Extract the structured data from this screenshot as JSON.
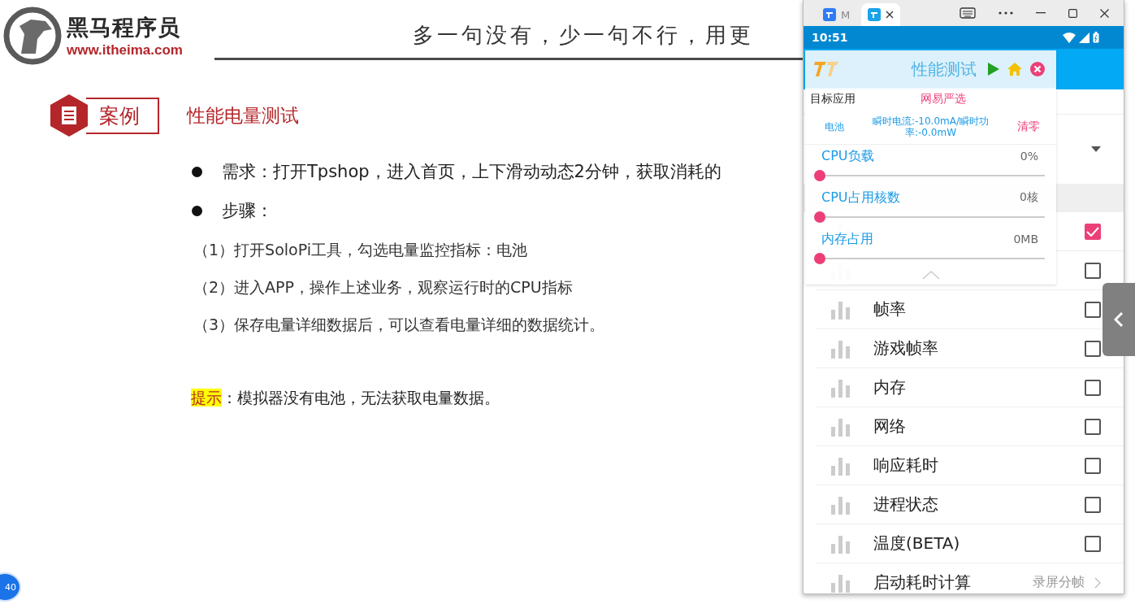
{
  "slide": {
    "brand": {
      "name": "黑马程序员",
      "url": "www.itheima.com"
    },
    "motto": "多一句没有，少一句不行，用更",
    "section": {
      "tag": "案例",
      "title": "性能电量测试"
    },
    "bullets": [
      "需求：打开Tpshop，进入首页，上下滑动动态2分钟，获取消耗的",
      "步骤："
    ],
    "steps": [
      "（1）打开SoloPi工具，勾选电量监控指标：电池",
      "（2）进入APP，操作上述业务，观察运行时的CPU指标",
      "（3）保存电量详细数据后，可以查看电量详细的数据统计。"
    ],
    "tip": {
      "label": "提示",
      "text": "：模拟器没有电池，无法获取电量数据。"
    },
    "page_badge": "40"
  },
  "window": {
    "tabs": [
      {
        "title": "M",
        "selected": false
      },
      {
        "selected": true
      }
    ]
  },
  "phone": {
    "time": "10:51",
    "overlay": {
      "title": "性能测试",
      "target_label": "目标应用",
      "target_value": "网易严选",
      "battery": {
        "label": "电池",
        "reading": "瞬时电流:-10.0mA/瞬时功率:-0.0mW",
        "reset": "清零"
      },
      "metrics": [
        {
          "label": "CPU负载",
          "value": "0%",
          "level": 0
        },
        {
          "label": "CPU占用核数",
          "value": "0核",
          "level": 0
        },
        {
          "label": "内存占用",
          "value": "0MB",
          "level": 0
        }
      ]
    },
    "items": [
      {
        "kind": "check",
        "checked": true
      },
      {
        "kind": "check",
        "checked": false
      },
      {
        "kind": "check",
        "label": "帧率",
        "checked": false
      },
      {
        "kind": "check",
        "label": "游戏帧率",
        "checked": false
      },
      {
        "kind": "check",
        "label": "内存",
        "checked": false
      },
      {
        "kind": "check",
        "label": "网络",
        "checked": false
      },
      {
        "kind": "check",
        "label": "响应耗时",
        "checked": false
      },
      {
        "kind": "check",
        "label": "进程状态",
        "checked": false
      },
      {
        "kind": "check",
        "label": "温度(BETA)",
        "checked": false
      },
      {
        "kind": "link",
        "label": "启动耗时计算",
        "value": "录屏分帧"
      }
    ]
  }
}
